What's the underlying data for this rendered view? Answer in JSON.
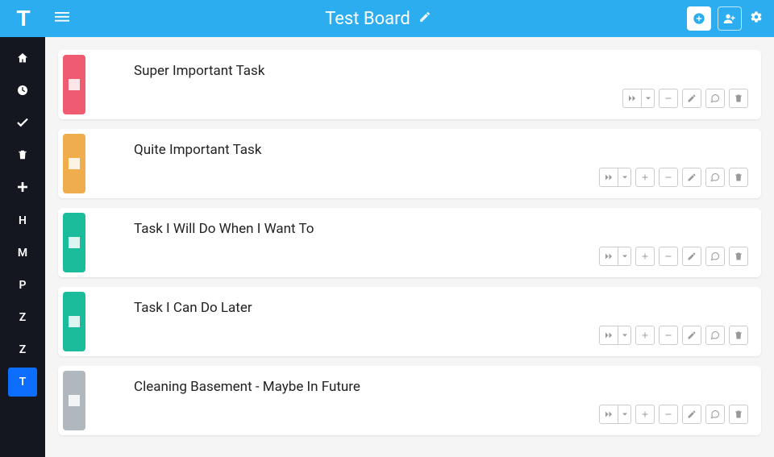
{
  "app": {
    "logo_letter": "T"
  },
  "sidebar": {
    "items": [
      {
        "type": "icon",
        "name": "home-icon",
        "glyph": "home"
      },
      {
        "type": "icon",
        "name": "clock-icon",
        "glyph": "clock"
      },
      {
        "type": "icon",
        "name": "check-icon",
        "glyph": "check"
      },
      {
        "type": "icon",
        "name": "trash-icon",
        "glyph": "trash"
      },
      {
        "type": "icon",
        "name": "plus-icon",
        "glyph": "plus"
      },
      {
        "type": "letter",
        "name": "board-h",
        "label": "H"
      },
      {
        "type": "letter",
        "name": "board-m",
        "label": "M"
      },
      {
        "type": "letter",
        "name": "board-p",
        "label": "P"
      },
      {
        "type": "letter",
        "name": "board-z1",
        "label": "Z"
      },
      {
        "type": "letter",
        "name": "board-z2",
        "label": "Z"
      },
      {
        "type": "letter",
        "name": "board-t",
        "label": "T",
        "active": true
      }
    ]
  },
  "header": {
    "title": "Test Board"
  },
  "tasks": [
    {
      "title": "Super Important Task",
      "priority_color": "p-red",
      "show_plus": false
    },
    {
      "title": "Quite Important Task",
      "priority_color": "p-orange",
      "show_plus": true
    },
    {
      "title": "Task I Will Do When I Want To",
      "priority_color": "p-green",
      "show_plus": true
    },
    {
      "title": "Task I Can Do Later",
      "priority_color": "p-green",
      "show_plus": true
    },
    {
      "title": "Cleaning Basement - Maybe In Future",
      "priority_color": "p-gray",
      "show_plus": true
    }
  ]
}
